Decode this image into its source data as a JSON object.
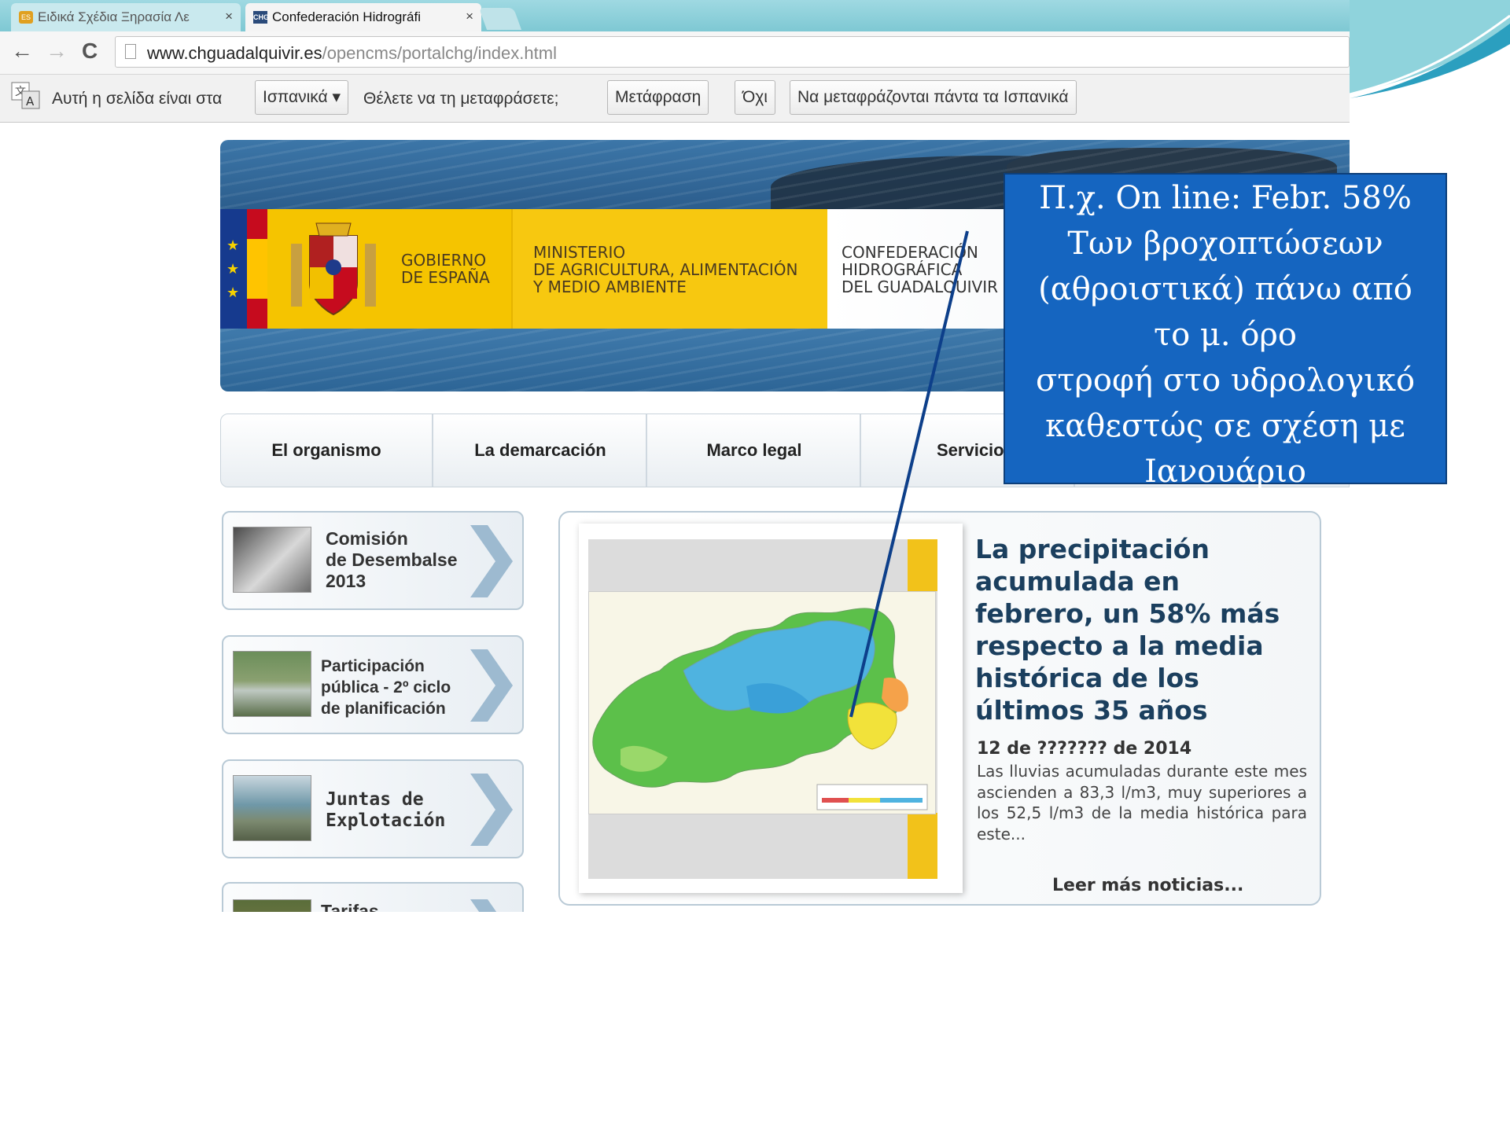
{
  "browser": {
    "tabs": [
      {
        "title": "Ειδικά Σχέδια Ξηρασία Λε",
        "close": "×",
        "favicon": "ES"
      },
      {
        "title": "Confederación Hidrográfi",
        "close": "×",
        "favicon": "CHG"
      }
    ],
    "url_host": "www.chguadalquivir.es",
    "url_path": "/opencms/portalchg/index.html",
    "nav": {
      "back": "←",
      "forward": "→",
      "reload": "C"
    }
  },
  "translate_bar": {
    "prefix": "Αυτή η σελίδα είναι στα",
    "language": "Ισπανικά ▾",
    "question": "Θέλετε να τη μεταφράσετε;",
    "translate_button": "Μετάφραση",
    "no_button": "Όχι",
    "always_button": "Να μεταφράζονται πάντα τα Ισπανικά"
  },
  "banner": {
    "gov": "GOBIERNO\nDE ESPAÑA",
    "ministry": "MINISTERIO\nDE AGRICULTURA, ALIMENTACIÓN\nY MEDIO AMBIENTE",
    "confederation": "CONFEDERACIÓN\nHIDROGRÁFICA\nDEL GUADALQUIVIR"
  },
  "menu": [
    "El organismo",
    "La demarcación",
    "Marco legal",
    "Servicios"
  ],
  "side_cards": [
    {
      "label": "Comisión\nde Desembalse\n2013"
    },
    {
      "label": "Participación\npública - 2º ciclo\nde planificación"
    },
    {
      "label": "Juntas de\nExplotación"
    },
    {
      "label": "Tarifas"
    }
  ],
  "news": {
    "title": "La precipitación acumulada en febrero, un 58% más respecto a la media histórica de los últimos 35 años",
    "date": "12 de ??????? de 2014",
    "body": "Las lluvias acumuladas durante este mes ascienden a 83,3 l/m3, muy superiores a los 52,5 l/m3 de la media histórica para este...",
    "more": "Leer más noticias..."
  },
  "callout": {
    "lines": [
      "Π.χ. On line: Febr. 58%",
      "Των βροχοπτώσεων",
      "(αθροιστικά) πάνω  από",
      "το μ. όρο",
      "στροφή στο υδρολογικό",
      "καθεστώς σε σχέση με",
      "Ιανουάριο"
    ]
  },
  "colors": {
    "callout_bg": "#1565c0",
    "pointer_line": "#0d3f8a",
    "news_title": "#1b3f5e",
    "gov_yellow": "#f5c400"
  }
}
